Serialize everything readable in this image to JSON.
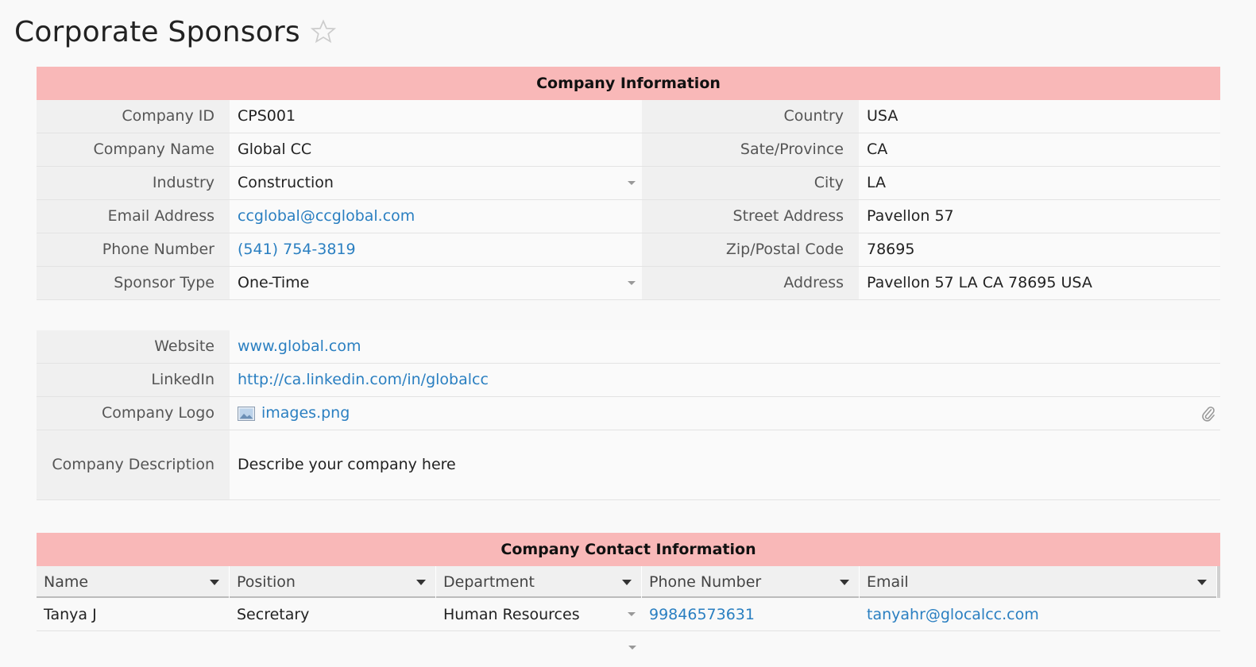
{
  "page": {
    "title": "Corporate Sponsors"
  },
  "colors": {
    "header_bg": "#f9b8b8",
    "link": "#2a7fc1",
    "label_bg": "#f0f0f0"
  },
  "company_info": {
    "header": "Company Information",
    "left": [
      {
        "label": "Company ID",
        "value": "CPS001",
        "type": "text"
      },
      {
        "label": "Company Name",
        "value": "Global CC",
        "type": "text"
      },
      {
        "label": "Industry",
        "value": "Construction",
        "type": "dropdown"
      },
      {
        "label": "Email Address",
        "value": "ccglobal@ccglobal.com",
        "type": "link"
      },
      {
        "label": "Phone Number",
        "value": "(541) 754-3819",
        "type": "link"
      },
      {
        "label": "Sponsor Type",
        "value": "One-Time",
        "type": "dropdown"
      }
    ],
    "right": [
      {
        "label": "Country",
        "value": "USA"
      },
      {
        "label": "Sate/Province",
        "value": "CA"
      },
      {
        "label": "City",
        "value": "LA"
      },
      {
        "label": "Street Address",
        "value": "Pavellon 57"
      },
      {
        "label": "Zip/Postal Code",
        "value": "78695"
      },
      {
        "label": "Address",
        "value": "Pavellon 57 LA CA 78695 USA"
      }
    ]
  },
  "details": {
    "website_label": "Website",
    "website_value": "www.global.com",
    "linkedin_label": "LinkedIn",
    "linkedin_value": "http://ca.linkedin.com/in/globalcc",
    "logo_label": "Company Logo",
    "logo_value": "images.png",
    "description_label": "Company Description",
    "description_value": "Describe your company here"
  },
  "contacts": {
    "header": "Company Contact Information",
    "columns": [
      "Name",
      "Position",
      "Department",
      "Phone Number",
      "Email"
    ],
    "rows": [
      {
        "name": "Tanya J",
        "position": "Secretary",
        "department": "Human Resources",
        "phone": "99846573631",
        "email": "tanyahr@glocalcc.com"
      }
    ]
  }
}
